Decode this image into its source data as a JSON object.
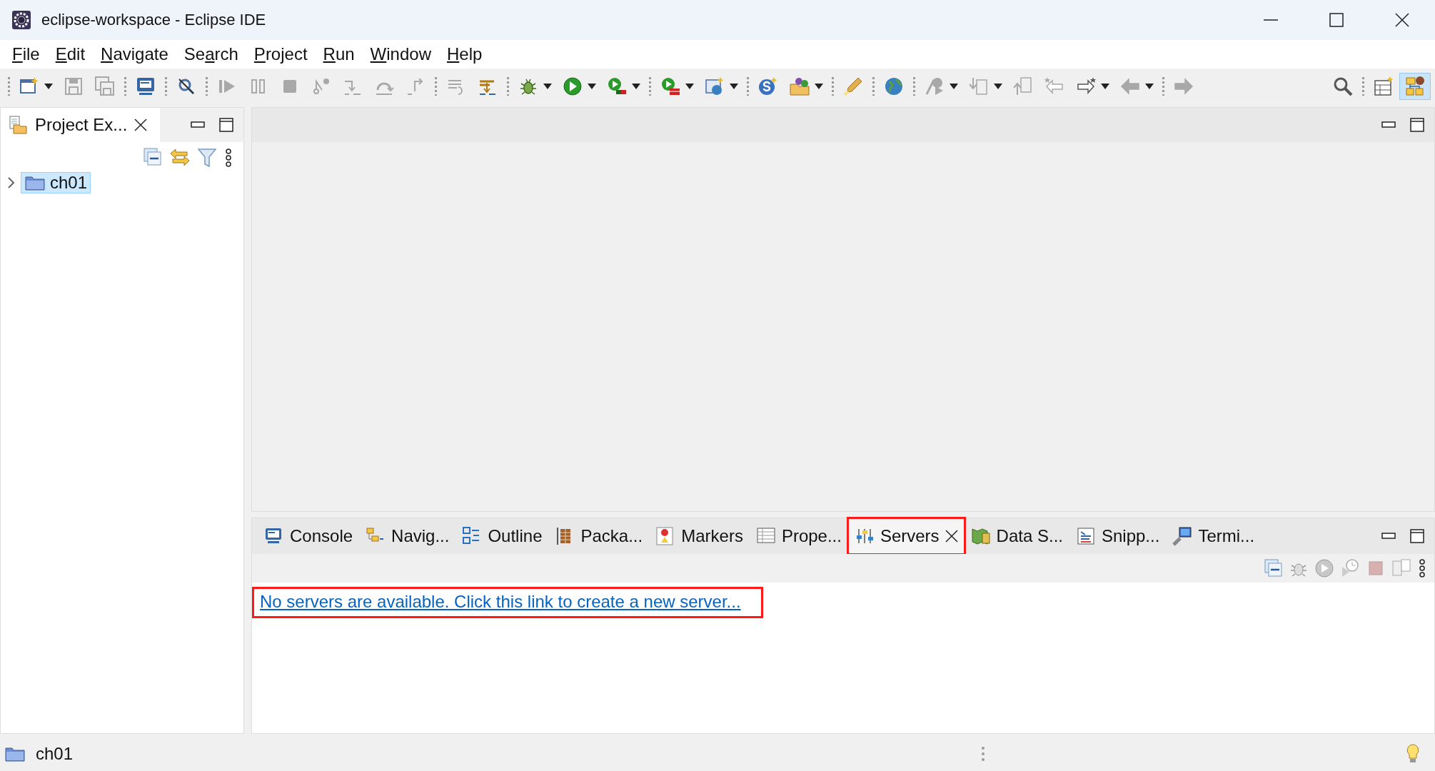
{
  "window": {
    "title": "eclipse-workspace - Eclipse IDE"
  },
  "menu": [
    {
      "key": "F",
      "after": "ile"
    },
    {
      "key": "E",
      "after": "dit"
    },
    {
      "key": "N",
      "after": "avigate"
    },
    {
      "before": "Se",
      "key": "a",
      "after": "rch"
    },
    {
      "key": "P",
      "after": "roject"
    },
    {
      "key": "R",
      "after": "un"
    },
    {
      "key": "W",
      "after": "indow"
    },
    {
      "key": "H",
      "after": "elp"
    }
  ],
  "toolbar": {
    "groups": [
      [
        {
          "disabled": false,
          "dropdown": true
        },
        {
          "disabled": true,
          "dropdown": false
        },
        {
          "disabled": true,
          "dropdown": false
        }
      ],
      [
        {
          "disabled": false,
          "dropdown": false
        }
      ],
      [
        {
          "disabled": false,
          "dropdown": false
        }
      ],
      [
        {
          "disabled": true,
          "dropdown": false
        },
        {
          "disabled": true,
          "dropdown": false
        },
        {
          "disabled": true,
          "dropdown": false
        },
        {
          "disabled": true,
          "dropdown": false
        },
        {
          "disabled": true,
          "dropdown": false
        },
        {
          "disabled": true,
          "dropdown": false
        },
        {
          "disabled": true,
          "dropdown": false
        }
      ],
      [
        {
          "disabled": true,
          "dropdown": false
        },
        {
          "disabled": false,
          "dropdown": false
        }
      ],
      [
        {
          "disabled": false,
          "dropdown": true
        },
        {
          "disabled": false,
          "dropdown": true
        },
        {
          "disabled": false,
          "dropdown": true
        }
      ],
      [
        {
          "disabled": false,
          "dropdown": true
        },
        {
          "disabled": false,
          "dropdown": true
        }
      ],
      [
        {
          "disabled": false,
          "dropdown": false
        },
        {
          "disabled": false,
          "dropdown": true
        }
      ],
      [
        {
          "disabled": false,
          "dropdown": false
        }
      ],
      [
        {
          "disabled": false,
          "dropdown": false
        }
      ],
      [
        {
          "disabled": true,
          "dropdown": true
        },
        {
          "disabled": true,
          "dropdown": true
        },
        {
          "disabled": true,
          "dropdown": false
        },
        {
          "disabled": true,
          "dropdown": false
        },
        {
          "disabled": false,
          "dropdown": true
        },
        {
          "disabled": true,
          "dropdown": true
        }
      ],
      [
        {
          "disabled": true,
          "dropdown": false
        }
      ]
    ],
    "perspectives": [
      {
        "selected": false
      },
      {
        "selected": true
      }
    ]
  },
  "project_explorer": {
    "tab": {
      "label": "Project Ex...",
      "selected": true
    },
    "tree": [
      {
        "label": "ch01",
        "selected": true,
        "expanded": false
      }
    ]
  },
  "bottom_panel": {
    "tabs": [
      {
        "label": "Console",
        "selected": false,
        "highlighted": false
      },
      {
        "label": "Navig...",
        "selected": false,
        "highlighted": false
      },
      {
        "label": "Outline",
        "selected": false,
        "highlighted": false
      },
      {
        "label": "Packa...",
        "selected": false,
        "highlighted": false
      },
      {
        "label": "Markers",
        "selected": false,
        "highlighted": false
      },
      {
        "label": "Prope...",
        "selected": false,
        "highlighted": false
      },
      {
        "label": "Servers",
        "selected": true,
        "highlighted": true
      },
      {
        "label": "Data S...",
        "selected": false,
        "highlighted": false
      },
      {
        "label": "Snipp...",
        "selected": false,
        "highlighted": false
      },
      {
        "label": "Termi...",
        "selected": false,
        "highlighted": false
      }
    ],
    "link": {
      "text": "No servers are available. Click this link to create a new server...",
      "highlighted": true
    }
  },
  "status_bar": {
    "text": "ch01"
  }
}
